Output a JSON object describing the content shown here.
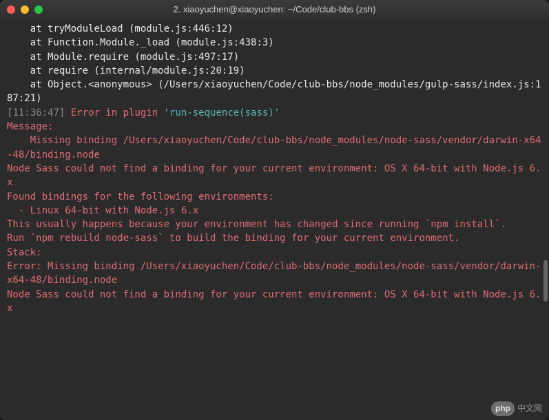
{
  "window": {
    "title": "2. xiaoyuchen@xiaoyuchen: ~/Code/club-bbs (zsh)"
  },
  "colors": {
    "background": "#2b2b2b",
    "text": "#e8e8e8",
    "error": "#e06c75",
    "cyan": "#5fb3b3",
    "grey": "#888888",
    "close": "#ff5f57",
    "minimize": "#ffbd2e",
    "maximize": "#28ca42"
  },
  "stack": {
    "l1": "    at tryModuleLoad (module.js:446:12)",
    "l2": "    at Function.Module._load (module.js:438:3)",
    "l3": "    at Module.require (module.js:497:17)",
    "l4": "    at require (internal/module.js:20:19)",
    "l5": "    at Object.<anonymous> (/Users/xiaoyuchen/Code/club-bbs/node_modules/gulp-sass/index.js:187:21)"
  },
  "log_prefix": {
    "bracket_open": "[",
    "time": "11:36:47",
    "bracket_close": "] ",
    "error_text": "Error in plugin ",
    "quote1": "'",
    "plugin": "run-sequence(sass)",
    "quote2": "'"
  },
  "msg": {
    "header": "Message:",
    "body": "    Missing binding /Users/xiaoyuchen/Code/club-bbs/node_modules/node-sass/vendor/darwin-x64-48/binding.node",
    "nosass": "Node Sass could not find a binding for your current environment: OS X 64-bit with Node.js 6.x",
    "blank": "",
    "found": "Found bindings for the following environments:",
    "env": "  - Linux 64-bit with Node.js 6.x",
    "usually": "This usually happens because your environment has changed since running `npm install`.",
    "run": "Run `npm rebuild node-sass` to build the binding for your current environment.",
    "stackh": "Stack:",
    "stackerr": "Error: Missing binding /Users/xiaoyuchen/Code/club-bbs/node_modules/node-sass/vendor/darwin-x64-48/binding.node",
    "nosass2": "Node Sass could not find a binding for your current environment: OS X 64-bit with Node.js 6.x"
  },
  "watermark": {
    "badge": "php",
    "text": "中文网"
  }
}
